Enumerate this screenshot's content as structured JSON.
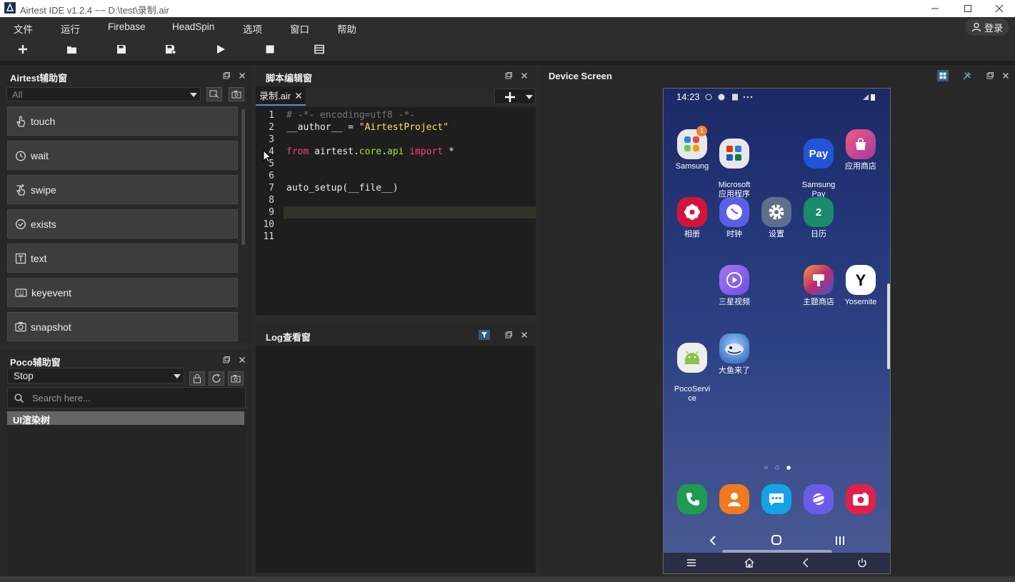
{
  "window": {
    "title": "Airtest IDE v1.2.4 ~~ D:\\test\\录制.air"
  },
  "menu": {
    "items": [
      "文件",
      "运行",
      "Firebase",
      "HeadSpin",
      "选项",
      "窗口",
      "帮助"
    ],
    "login": "登录"
  },
  "airtest_panel": {
    "title": "Airtest辅助窗",
    "filter_value": "All",
    "buttons": [
      "touch",
      "wait",
      "swipe",
      "exists",
      "text",
      "keyevent",
      "snapshot"
    ]
  },
  "poco_panel": {
    "title": "Poco辅助窗",
    "mode_value": "Stop",
    "search_placeholder": "Search here...",
    "tree_label": "UI渲染树"
  },
  "editor_panel": {
    "title": "脚本编辑窗",
    "tab_name": "录制.air",
    "line_numbers": [
      "1",
      "2",
      "3",
      "4",
      "5",
      "6",
      "7",
      "8",
      "9",
      "10",
      "11"
    ],
    "code": {
      "l1": "# -*- encoding=utf8 -*-",
      "l2a": "__author__ = ",
      "l2b": "\"AirtestProject\"",
      "l4a": "from",
      "l4b": " airtest.",
      "l4c": "core",
      "l4d": ".",
      "l4e": "api",
      "l4f": " ",
      "l4g": "import",
      "l4h": " *",
      "l7": "auto_setup(__file__)"
    }
  },
  "log_panel": {
    "title": "Log查看窗"
  },
  "device_panel": {
    "title": "Device Screen",
    "phone": {
      "time": "14:23",
      "badge": "1",
      "apps": [
        {
          "label": "Samsung",
          "icon": "samsung-folder-icon",
          "color": "#e8e8ea"
        },
        {
          "label": "Microsoft\n应用程序",
          "icon": "microsoft-folder-icon",
          "color": "#e8e8ea"
        },
        {
          "label": "Samsung\nPay",
          "icon": "samsung-pay-icon",
          "color": "#1f55d6",
          "glyph": "Pay"
        },
        {
          "label": "应用商店",
          "icon": "app-store-icon",
          "color": "#d2306e"
        },
        {
          "label": "相册",
          "icon": "gallery-icon",
          "color": "#d3133a"
        },
        {
          "label": "时钟",
          "icon": "clock-icon",
          "color": "#5b5fe6"
        },
        {
          "label": "设置",
          "icon": "settings-icon",
          "color": "#5d6f8a"
        },
        {
          "label": "日历",
          "icon": "calendar-icon",
          "color": "#1b8a6d",
          "glyph": "2"
        },
        {
          "label": "三星视频",
          "icon": "video-icon",
          "color": "#8a5cf0"
        },
        {
          "label": "主题商店",
          "icon": "theme-store-icon",
          "color": "#c73a4e"
        },
        {
          "label": "Yosemite",
          "icon": "yosemite-icon",
          "color": "#ffffff",
          "glyph": "Y"
        },
        {
          "label": "PocoServi\nce",
          "icon": "android-icon",
          "color": "#eeeeee"
        },
        {
          "label": "大鱼来了",
          "icon": "game-icon",
          "color": "#3c7bd6"
        }
      ],
      "dock": [
        {
          "icon": "phone-app-icon",
          "color": "#1f9a53"
        },
        {
          "icon": "contacts-icon",
          "color": "#f07a20"
        },
        {
          "icon": "messages-icon",
          "color": "#15a3e6"
        },
        {
          "icon": "internet-icon",
          "color": "#6b5ce8"
        },
        {
          "icon": "camera-icon",
          "color": "#e0204a"
        }
      ]
    }
  }
}
